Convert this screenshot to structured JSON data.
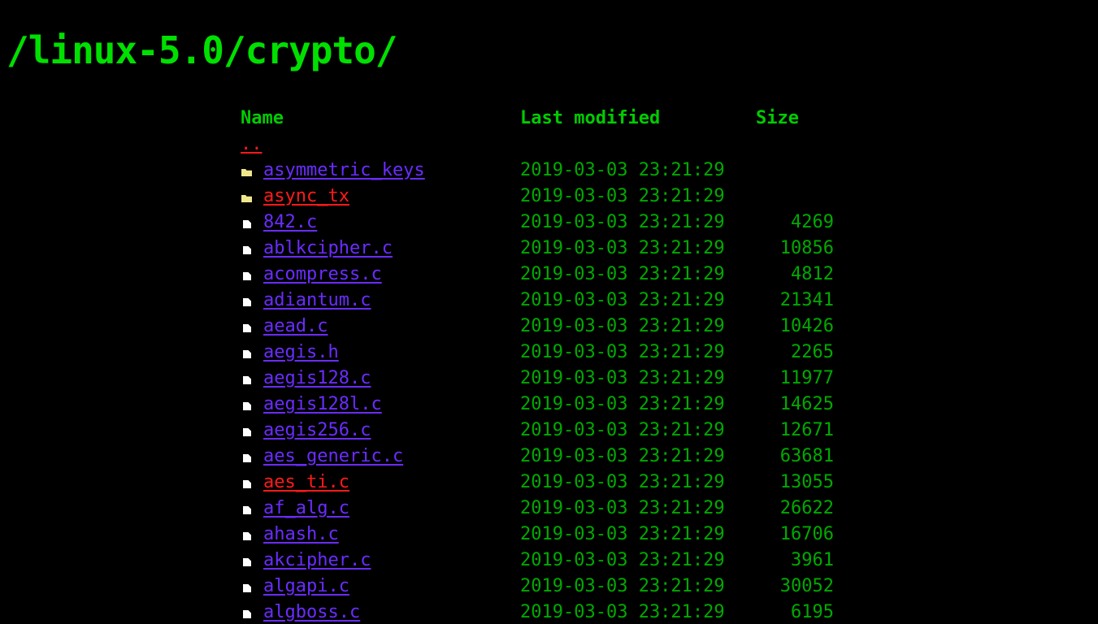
{
  "page": {
    "title": "/linux-5.0/crypto/"
  },
  "columns": {
    "name": "Name",
    "last_modified": "Last modified",
    "size": "Size"
  },
  "parent": {
    "label": "..",
    "color": "#ff1a1a"
  },
  "entries": [
    {
      "type": "folder",
      "name": "asymmetric_keys",
      "modified": "2019-03-03 23:21:29",
      "size": "",
      "link_color": "#6a2cff"
    },
    {
      "type": "folder",
      "name": "async_tx",
      "modified": "2019-03-03 23:21:29",
      "size": "",
      "link_color": "#ff1a1a"
    },
    {
      "type": "file",
      "name": "842.c",
      "modified": "2019-03-03 23:21:29",
      "size": "4269",
      "link_color": "#6a2cff"
    },
    {
      "type": "file",
      "name": "ablkcipher.c",
      "modified": "2019-03-03 23:21:29",
      "size": "10856",
      "link_color": "#6a2cff"
    },
    {
      "type": "file",
      "name": "acompress.c",
      "modified": "2019-03-03 23:21:29",
      "size": "4812",
      "link_color": "#6a2cff"
    },
    {
      "type": "file",
      "name": "adiantum.c",
      "modified": "2019-03-03 23:21:29",
      "size": "21341",
      "link_color": "#6a2cff"
    },
    {
      "type": "file",
      "name": "aead.c",
      "modified": "2019-03-03 23:21:29",
      "size": "10426",
      "link_color": "#6a2cff"
    },
    {
      "type": "file",
      "name": "aegis.h",
      "modified": "2019-03-03 23:21:29",
      "size": "2265",
      "link_color": "#6a2cff"
    },
    {
      "type": "file",
      "name": "aegis128.c",
      "modified": "2019-03-03 23:21:29",
      "size": "11977",
      "link_color": "#6a2cff"
    },
    {
      "type": "file",
      "name": "aegis128l.c",
      "modified": "2019-03-03 23:21:29",
      "size": "14625",
      "link_color": "#6a2cff"
    },
    {
      "type": "file",
      "name": "aegis256.c",
      "modified": "2019-03-03 23:21:29",
      "size": "12671",
      "link_color": "#6a2cff"
    },
    {
      "type": "file",
      "name": "aes_generic.c",
      "modified": "2019-03-03 23:21:29",
      "size": "63681",
      "link_color": "#6a2cff"
    },
    {
      "type": "file",
      "name": "aes_ti.c",
      "modified": "2019-03-03 23:21:29",
      "size": "13055",
      "link_color": "#ff1a1a"
    },
    {
      "type": "file",
      "name": "af_alg.c",
      "modified": "2019-03-03 23:21:29",
      "size": "26622",
      "link_color": "#6a2cff"
    },
    {
      "type": "file",
      "name": "ahash.c",
      "modified": "2019-03-03 23:21:29",
      "size": "16706",
      "link_color": "#6a2cff"
    },
    {
      "type": "file",
      "name": "akcipher.c",
      "modified": "2019-03-03 23:21:29",
      "size": "3961",
      "link_color": "#6a2cff"
    },
    {
      "type": "file",
      "name": "algapi.c",
      "modified": "2019-03-03 23:21:29",
      "size": "30052",
      "link_color": "#6a2cff"
    },
    {
      "type": "file",
      "name": "algboss.c",
      "modified": "2019-03-03 23:21:29",
      "size": "6195",
      "link_color": "#6a2cff"
    }
  ],
  "icons": {
    "folder": "folder-icon",
    "file": "file-icon"
  },
  "colors": {
    "background": "#000000",
    "text_green": "#00cc00",
    "link_purple": "#6a2cff",
    "link_red": "#ff1a1a"
  }
}
